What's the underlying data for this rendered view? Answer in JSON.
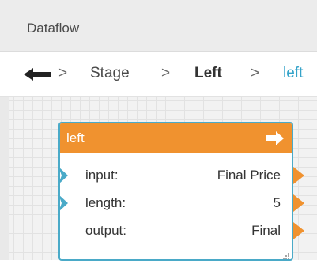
{
  "window": {
    "title": "Dataflow"
  },
  "breadcrumb": {
    "back_icon": "left-arrow-icon",
    "separator": ">",
    "items": [
      "Stage",
      "Left",
      "left"
    ]
  },
  "node": {
    "title": "left",
    "header_icon": "right-arrow-icon",
    "colors": {
      "header": "#f0922f",
      "border": "#4aaac8",
      "in_port": "#4aaac8",
      "out_port": "#f0922f"
    },
    "rows": [
      {
        "label": "input:",
        "value": "Final Price",
        "has_input": true,
        "has_output": true
      },
      {
        "label": "length:",
        "value": "5",
        "has_input": true,
        "has_output": true
      },
      {
        "label": "output:",
        "value": "Final",
        "has_input": false,
        "has_output": true
      }
    ]
  }
}
